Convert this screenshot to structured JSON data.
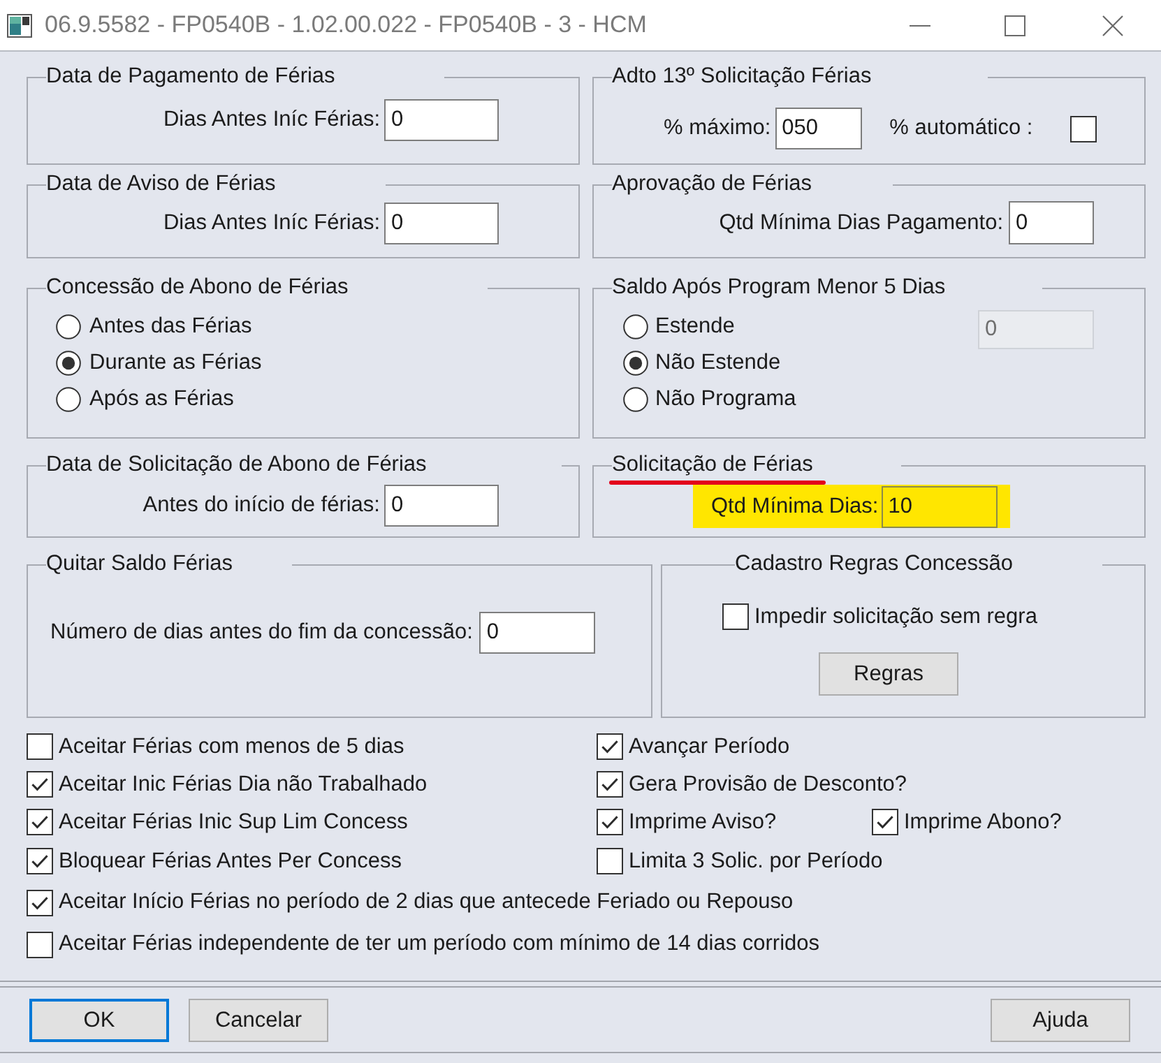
{
  "window": {
    "title": "06.9.5582 - FP0540B - 1.02.00.022 - FP0540B - 3 - HCM"
  },
  "groups": [
    {
      "title": "Data de Pagamento de Férias",
      "underlined": false,
      "items": [
        {
          "kind": "field",
          "label": "Dias Antes Iníc Férias:",
          "value": "0",
          "disabled": false,
          "highlighted": false
        }
      ]
    },
    {
      "title": "Adto 13º Solicitação Férias",
      "underlined": false,
      "items": [
        {
          "kind": "field",
          "label": "% máximo:",
          "value": "050",
          "disabled": false,
          "highlighted": false
        },
        {
          "kind": "checkbox",
          "label": "% automático :",
          "checked": false
        }
      ]
    },
    {
      "title": "Data de Aviso de Férias",
      "underlined": false,
      "items": [
        {
          "kind": "field",
          "label": "Dias Antes Iníc Férias:",
          "value": "0",
          "disabled": false,
          "highlighted": false
        }
      ]
    },
    {
      "title": "Aprovação de Férias",
      "underlined": false,
      "items": [
        {
          "kind": "field",
          "label": "Qtd Mínima Dias Pagamento:",
          "value": "0",
          "disabled": false,
          "highlighted": false
        }
      ]
    },
    {
      "title": "Concessão de Abono de Férias",
      "underlined": false,
      "items": [
        {
          "kind": "radio",
          "label": "Antes das Férias",
          "selected": false
        },
        {
          "kind": "radio",
          "label": "Durante as Férias",
          "selected": true
        },
        {
          "kind": "radio",
          "label": "Após as Férias",
          "selected": false
        }
      ]
    },
    {
      "title": "Saldo Após Program Menor 5 Dias",
      "underlined": false,
      "items": [
        {
          "kind": "radio",
          "label": "Estende",
          "selected": false
        },
        {
          "kind": "radio",
          "label": "Não Estende",
          "selected": true
        },
        {
          "kind": "radio",
          "label": "Não Programa",
          "selected": false
        },
        {
          "kind": "field",
          "value": "0",
          "disabled": true,
          "highlighted": false
        }
      ]
    },
    {
      "title": "Data de Solicitação de Abono de Férias",
      "underlined": false,
      "items": [
        {
          "kind": "field",
          "label": "Antes do início de férias:",
          "value": "0",
          "disabled": false,
          "highlighted": false
        }
      ]
    },
    {
      "title": "Solicitação de Férias",
      "underlined": true,
      "items": [
        {
          "kind": "field",
          "label": "Qtd Mínima Dias:",
          "value": "10",
          "disabled": false,
          "highlighted": true
        }
      ]
    },
    {
      "title": "Quitar Saldo Férias",
      "underlined": false,
      "items": [
        {
          "kind": "field",
          "label": "Número de dias antes do fim da concessão:",
          "value": "0",
          "disabled": false,
          "highlighted": false
        }
      ]
    },
    {
      "title": "Cadastro Regras Concessão",
      "underlined": false,
      "items": [
        {
          "kind": "checkbox",
          "label": "Impedir solicitação sem regra",
          "checked": false
        },
        {
          "kind": "button",
          "label": "Regras"
        }
      ]
    }
  ],
  "options": [
    [
      {
        "label": "Aceitar Férias com menos de 5 dias",
        "checked": false
      },
      {
        "label": "Avançar Período",
        "checked": true
      }
    ],
    [
      {
        "label": "Aceitar Inic Férias Dia não Trabalhado",
        "checked": true
      },
      {
        "label": "Gera Provisão de Desconto?",
        "checked": true
      }
    ],
    [
      {
        "label": "Aceitar Férias Inic Sup Lim Concess",
        "checked": true
      },
      {
        "label": "Imprime Aviso?",
        "checked": true
      },
      {
        "label": "Imprime Abono?",
        "checked": true
      }
    ],
    [
      {
        "label": "Bloquear Férias Antes Per Concess",
        "checked": true
      },
      {
        "label": "Limita 3 Solic. por Período",
        "checked": false
      }
    ],
    [
      {
        "label": "Aceitar Início Férias no período de 2 dias que antecede Feriado ou Repouso",
        "checked": true
      }
    ],
    [
      {
        "label": "Aceitar Férias independente de ter um período com mínimo de 14 dias corridos",
        "checked": false
      }
    ]
  ],
  "buttons": [
    {
      "label": "OK",
      "focused": true
    },
    {
      "label": "Cancelar",
      "focused": false
    },
    {
      "label": "Ajuda",
      "focused": false
    }
  ]
}
